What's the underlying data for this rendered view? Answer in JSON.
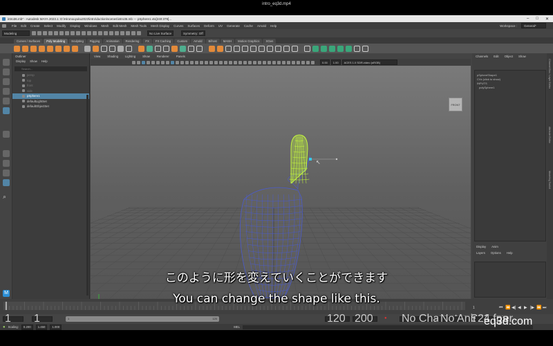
{
  "video": {
    "title": "intro_eq3d.mp4"
  },
  "titlebar": {
    "text": "intro36.mb* - Autodesk MAYA 2023.1: D:\\Hironouyuku2023\\intro\\duction\\scenes\\intro36.mb  ---  pSphere1.vtx[240:379]..."
  },
  "menus": [
    "File",
    "Edit",
    "Create",
    "Select",
    "Modify",
    "Display",
    "Windows",
    "Mesh",
    "Edit Mesh",
    "Mesh Tools",
    "Mesh Display",
    "Curves",
    "Surfaces",
    "Deform",
    "UV",
    "Generate",
    "Cache",
    "Arnold",
    "Help"
  ],
  "workspace": {
    "label": "Workspace :",
    "value": "General*"
  },
  "statusline": {
    "mode": "Modeling",
    "live_surface": "No Live Surface",
    "symmetry": "Symmetry: Off"
  },
  "shelf_tabs": [
    "Curves / Surfaces",
    "Poly Modeling",
    "Sculpting",
    "Rigging",
    "Animation",
    "Rendering",
    "FX",
    "FX Caching",
    "Custom",
    "Arnold",
    "Bifrost",
    "MASH",
    "Motion Graphics",
    "XGen"
  ],
  "shelf_active": "Poly Modeling",
  "outliner": {
    "title": "Outliner",
    "menu": [
      "Display",
      "Show",
      "Help"
    ],
    "search_placeholder": "Search...",
    "items": [
      {
        "label": "persp",
        "dim": true
      },
      {
        "label": "top",
        "dim": true
      },
      {
        "label": "front",
        "dim": true
      },
      {
        "label": "side",
        "dim": true
      },
      {
        "label": "pSphere1",
        "selected": true
      },
      {
        "label": "defaultLightSet"
      },
      {
        "label": "defaultObjectSet"
      }
    ]
  },
  "viewport": {
    "menu": [
      "View",
      "Shading",
      "Lighting",
      "Show",
      "Renderer",
      "Panels"
    ],
    "exposure": "0.00",
    "gamma": "1.00",
    "colorspace": "ACES 1.0 SDR-video (sRGB)",
    "viewcube_label": "FRONT"
  },
  "channelbox": {
    "menu": [
      "Channels",
      "Edit",
      "Object",
      "Show"
    ],
    "shape": "pSphereShape1",
    "cvs": "CVs (click to show)",
    "inputs": "INPUTS",
    "input_item": "polySphere1",
    "layer_tabs": [
      "Display",
      "Anim"
    ],
    "layer_menu": [
      "Layers",
      "Options",
      "Help"
    ]
  },
  "side_tabs": [
    "Channel Box / Layer Editor",
    "Attribute Editor",
    "Modeling Toolkit"
  ],
  "timeline": {
    "start": "1",
    "end_field": "1",
    "current": "1",
    "range_start": "1",
    "range_mid": "120",
    "range_end": "120",
    "range_max": "200",
    "fps": "24 fps",
    "character_set": "No Character Set",
    "anim_layer": "No Anim Layer"
  },
  "cmdline": {
    "lang": "MEL",
    "scaling_label": "Scaling:",
    "sx": "0.200",
    "sy": "1.450",
    "sz": "1.000"
  },
  "subtitles": {
    "jp": "このように形を変えていくことができます",
    "en": "You can change the shape like this."
  },
  "brand": "eq3d.com",
  "colors": {
    "selection": "#5285a6",
    "wire": "#4a5bd0",
    "vertex": "#c9ff3c",
    "manip": "#39c8e6"
  }
}
